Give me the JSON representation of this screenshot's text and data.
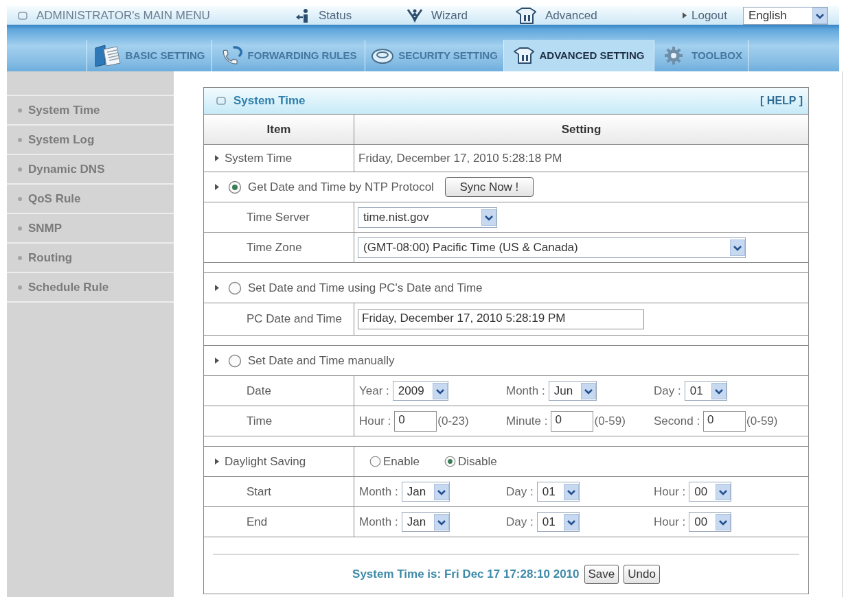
{
  "top_bar": {
    "title": "ADMINISTRATOR's MAIN MENU",
    "links": [
      "Status",
      "Wizard",
      "Advanced"
    ],
    "logout": "Logout",
    "language": "English"
  },
  "tabs": [
    {
      "label": "BASIC SETTING",
      "selected": false
    },
    {
      "label": "FORWARDING RULES",
      "selected": false
    },
    {
      "label": "SECURITY SETTING",
      "selected": false
    },
    {
      "label": "ADVANCED SETTING",
      "selected": true
    },
    {
      "label": "TOOLBOX",
      "selected": false
    }
  ],
  "sidebar": {
    "items": [
      "System Time",
      "System Log",
      "Dynamic DNS",
      "QoS Rule",
      "SNMP",
      "Routing",
      "Schedule Rule"
    ]
  },
  "panel": {
    "title": "System Time",
    "help": "[ HELP ]",
    "columns": [
      "Item",
      "Setting"
    ],
    "sections": [
      {
        "rows": [
          {
            "kind": "info",
            "label": "System Time",
            "value": "Friday, December 17, 2010 5:28:18 PM"
          },
          {
            "kind": "option",
            "label": "Get Date and Time by NTP Protocol",
            "selected": true,
            "button": "Sync Now !"
          },
          {
            "kind": "select",
            "label": "Time Server",
            "value": "time.nist.gov"
          },
          {
            "kind": "wideselect",
            "label": "Time Zone",
            "value": "(GMT-08:00) Pacific Time (US & Canada)"
          }
        ]
      },
      {
        "rows": [
          {
            "kind": "option",
            "label": "Set Date and Time using PC's Date and Time",
            "selected": false
          },
          {
            "kind": "input",
            "label": "PC Date and Time",
            "value": "Friday, December 17, 2010 5:28:19 PM"
          }
        ]
      },
      {
        "rows": [
          {
            "kind": "option",
            "label": "Set Date and Time manually",
            "selected": false
          },
          {
            "kind": "fields",
            "label": "Date",
            "fields": [
              {
                "kind": "select",
                "label": "Year :",
                "value": "2009"
              },
              {
                "kind": "select",
                "label": "Month :",
                "value": "Jun"
              },
              {
                "kind": "select",
                "label": "Day :",
                "value": "01"
              }
            ]
          },
          {
            "kind": "fields",
            "label": "Time",
            "fields": [
              {
                "kind": "input",
                "label": "Hour :",
                "value": "0",
                "range": "(0-23)"
              },
              {
                "kind": "input",
                "label": "Minute :",
                "value": "0",
                "range": "(0-59)"
              },
              {
                "kind": "input",
                "label": "Second :",
                "value": "0",
                "range": "(0-59)"
              }
            ]
          }
        ]
      },
      {
        "rows": [
          {
            "kind": "radios",
            "label": "Daylight Saving",
            "options": [
              {
                "label": "Enable",
                "selected": false
              },
              {
                "label": "Disable",
                "selected": true
              }
            ]
          },
          {
            "kind": "fields",
            "label": "Start",
            "fields": [
              {
                "kind": "select",
                "label": "Month :",
                "value": "Jan"
              },
              {
                "kind": "select",
                "label": "Day :",
                "value": "01"
              },
              {
                "kind": "select",
                "label": "Hour :",
                "value": "00"
              }
            ]
          },
          {
            "kind": "fields",
            "label": "End",
            "fields": [
              {
                "kind": "select",
                "label": "Month :",
                "value": "Jan"
              },
              {
                "kind": "select",
                "label": "Day :",
                "value": "01"
              },
              {
                "kind": "select",
                "label": "Hour :",
                "value": "00"
              }
            ]
          }
        ]
      }
    ],
    "status": "System Time is: Fri Dec 17 17:28:10 2010",
    "buttons": [
      "Save",
      "Undo"
    ]
  }
}
